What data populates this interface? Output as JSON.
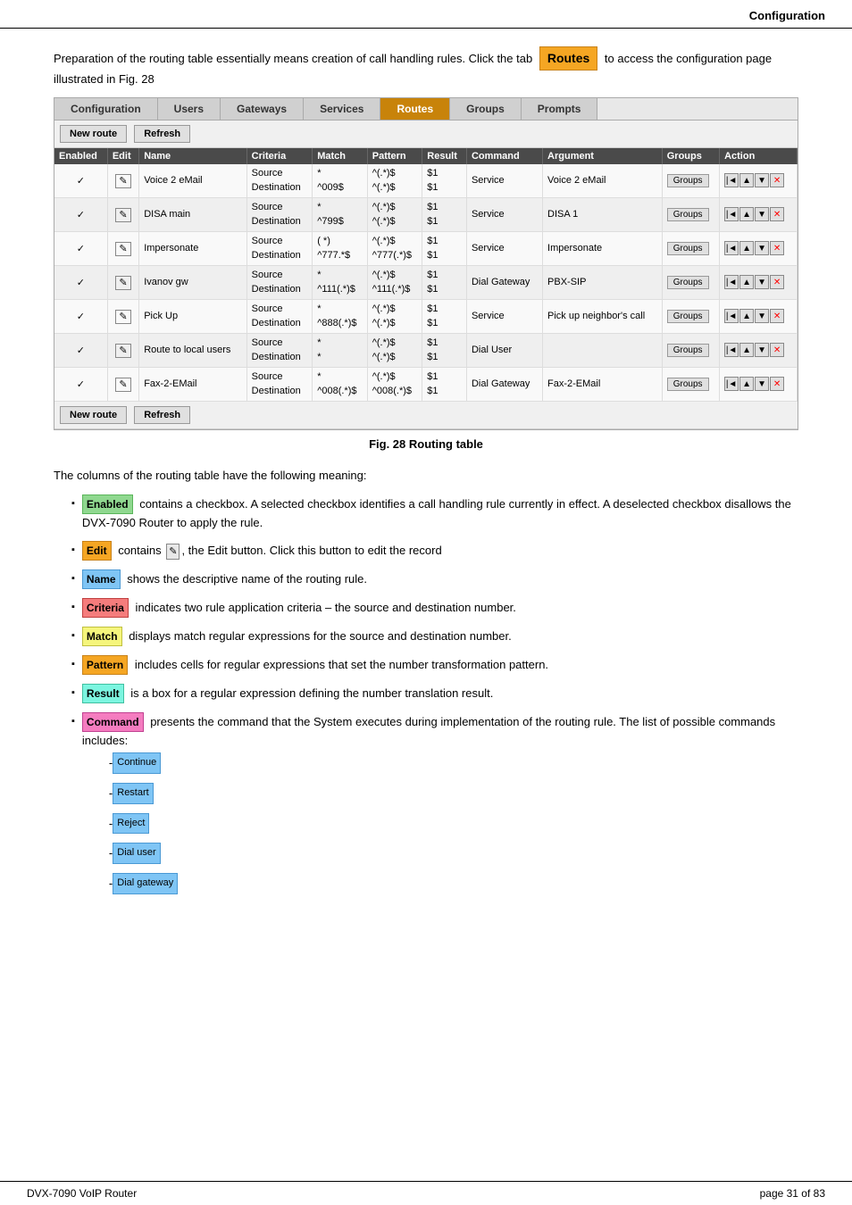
{
  "header": {
    "title": "Configuration"
  },
  "footer": {
    "left": "DVX-7090 VoIP Router",
    "right": "page 31 of 83"
  },
  "intro": {
    "text1": "Preparation of the routing table essentially means creation of call handling rules. Click the tab",
    "routes_label": "Routes",
    "text2": "to access the configuration page illustrated in Fig. 28"
  },
  "nav": {
    "tabs": [
      {
        "label": "Configuration",
        "active": false
      },
      {
        "label": "Users",
        "active": false
      },
      {
        "label": "Gateways",
        "active": false
      },
      {
        "label": "Services",
        "active": false
      },
      {
        "label": "Routes",
        "active": true
      },
      {
        "label": "Groups",
        "active": false
      },
      {
        "label": "Prompts",
        "active": false
      }
    ]
  },
  "toolbar": {
    "btn1": "New route",
    "btn2": "Refresh"
  },
  "table": {
    "headers": [
      "Enabled",
      "Edit",
      "Name",
      "Criteria",
      "Match",
      "Pattern",
      "Result",
      "Command",
      "Argument",
      "Groups",
      "Action"
    ],
    "rows": [
      {
        "enabled": "✓",
        "edit": "✎",
        "name": "Voice 2 eMail",
        "criteria": [
          "Source",
          "Destination"
        ],
        "match": [
          "*",
          "^009$"
        ],
        "pattern": [
          "^(.*)$",
          "^(.*)$"
        ],
        "result": [
          "$1",
          "$1"
        ],
        "command": "Service",
        "argument": "Voice 2 eMail",
        "groups": "Groups"
      },
      {
        "enabled": "✓",
        "edit": "✎",
        "name": "DISA main",
        "criteria": [
          "Source",
          "Destination"
        ],
        "match": [
          "*",
          "^799$"
        ],
        "pattern": [
          "^(.*)$",
          "^(.*)$"
        ],
        "result": [
          "$1",
          "$1"
        ],
        "command": "Service",
        "argument": "DISA 1",
        "groups": "Groups"
      },
      {
        "enabled": "✓",
        "edit": "✎",
        "name": "Impersonate",
        "criteria": [
          "Source",
          "Destination"
        ],
        "match": [
          "( *)",
          "^777.*$"
        ],
        "pattern": [
          "^(.*)$",
          "^777(.*)$"
        ],
        "result": [
          "$1",
          "$1"
        ],
        "command": "Service",
        "argument": "Impersonate",
        "groups": "Groups"
      },
      {
        "enabled": "✓",
        "edit": "✎",
        "name": "Ivanov gw",
        "criteria": [
          "Source",
          "Destination"
        ],
        "match": [
          "*",
          "^111(.*)$"
        ],
        "pattern": [
          "^(.*)$",
          "^111(.*)$"
        ],
        "result": [
          "$1",
          "$1"
        ],
        "command": "Dial Gateway",
        "argument": "PBX-SIP",
        "groups": "Groups"
      },
      {
        "enabled": "✓",
        "edit": "✎",
        "name": "Pick Up",
        "criteria": [
          "Source",
          "Destination"
        ],
        "match": [
          "*",
          "^888(.*)$"
        ],
        "pattern": [
          "^(.*)$",
          "^(.*)$"
        ],
        "result": [
          "$1",
          "$1"
        ],
        "command": "Service",
        "argument": "Pick up neighbor's call",
        "groups": "Groups"
      },
      {
        "enabled": "✓",
        "edit": "✎",
        "name": "Route to local users",
        "criteria": [
          "Source",
          "Destination"
        ],
        "match": [
          "*",
          "*"
        ],
        "pattern": [
          "^(.*)$",
          "^(.*)$"
        ],
        "result": [
          "$1",
          "$1"
        ],
        "command": "Dial User",
        "argument": "",
        "groups": "Groups"
      },
      {
        "enabled": "✓",
        "edit": "✎",
        "name": "Fax-2-EMail",
        "criteria": [
          "Source",
          "Destination"
        ],
        "match": [
          "*",
          "^008(.*)$"
        ],
        "pattern": [
          "^(.*)$",
          "^008(.*)$"
        ],
        "result": [
          "$1",
          "$1"
        ],
        "command": "Dial Gateway",
        "argument": "Fax-2-EMail",
        "groups": "Groups"
      }
    ]
  },
  "fig_caption": "Fig. 28 Routing table",
  "description": {
    "intro": "The columns of the routing table have the following meaning:",
    "items": [
      {
        "term": "Enabled",
        "term_class": "green",
        "text": "contains a checkbox. A selected checkbox identifies a call handling rule currently in effect. A deselected checkbox disallows the DVX-7090 Router to apply the rule."
      },
      {
        "term": "Edit",
        "term_class": "orange",
        "text": "contains [icon], the Edit button. Click this button to edit the record"
      },
      {
        "term": "Name",
        "term_class": "blue",
        "text": "shows the descriptive name of the routing rule."
      },
      {
        "term": "Criteria",
        "term_class": "red",
        "text": "indicates two rule application criteria – the source and destination number."
      },
      {
        "term": "Match",
        "term_class": "yellow",
        "text": "displays match regular expressions for the source and destination number."
      },
      {
        "term": "Pattern",
        "term_class": "orange",
        "text": "includes cells for regular expressions that set the number transformation pattern."
      },
      {
        "term": "Result",
        "term_class": "teal",
        "text": "is a box for a regular expression defining the number translation result."
      },
      {
        "term": "Command",
        "term_class": "pink",
        "text": "presents the command that the System executes during implementation of the routing rule. The list of possible commands includes:"
      }
    ],
    "commands": [
      {
        "label": "Continue"
      },
      {
        "label": "Restart"
      },
      {
        "label": "Reject"
      },
      {
        "label": "Dial user"
      },
      {
        "label": "Dial gateway"
      }
    ]
  }
}
